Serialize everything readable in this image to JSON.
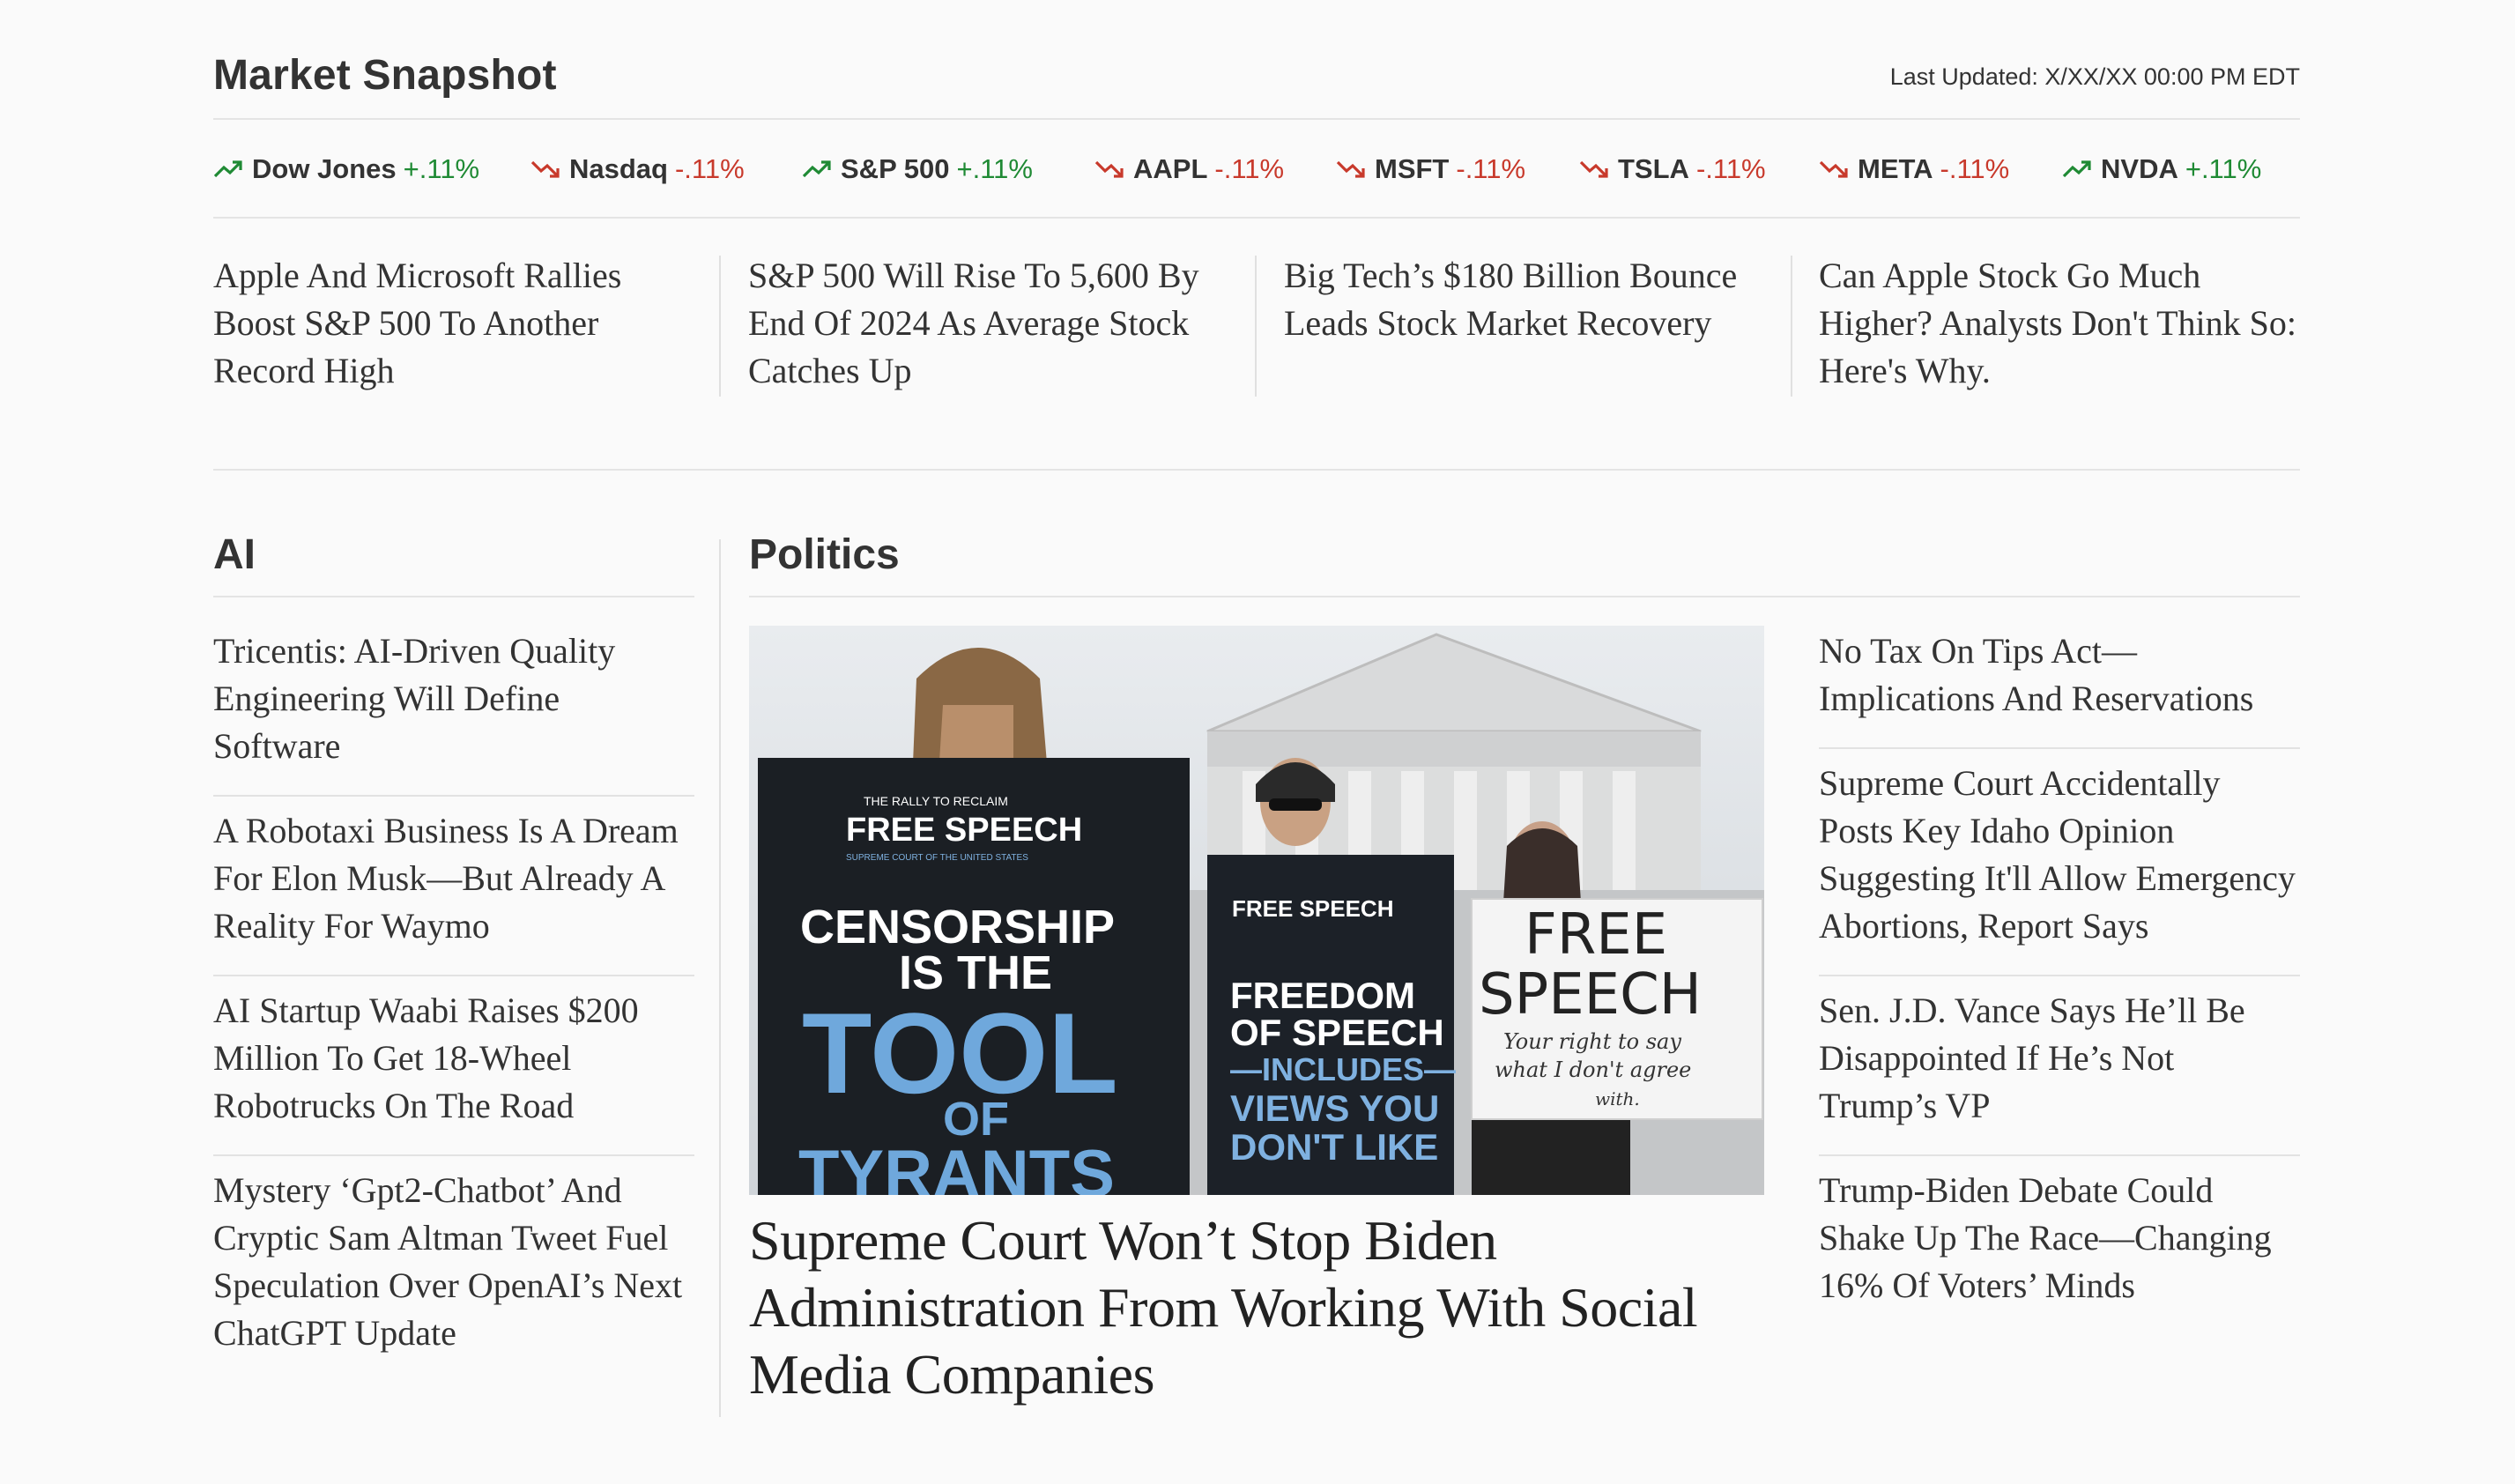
{
  "market": {
    "title": "Market Snapshot",
    "last_updated": "Last Updated: X/XX/XX 00:00 PM EDT",
    "tickers": [
      {
        "name": "Dow Jones",
        "change": "+.11%",
        "direction": "up"
      },
      {
        "name": "Nasdaq",
        "change": "-.11%",
        "direction": "down"
      },
      {
        "name": "S&P 500",
        "change": "+.11%",
        "direction": "up"
      },
      {
        "name": "AAPL",
        "change": "-.11%",
        "direction": "down"
      },
      {
        "name": "MSFT",
        "change": "-.11%",
        "direction": "down"
      },
      {
        "name": "TSLA",
        "change": "-.11%",
        "direction": "down"
      },
      {
        "name": "META",
        "change": "-.11%",
        "direction": "down"
      },
      {
        "name": "NVDA",
        "change": "+.11%",
        "direction": "up"
      }
    ],
    "headlines": [
      "Apple And Microsoft Rallies Boost S&P 500 To Another Record High",
      "S&P 500 Will Rise To 5,600 By End Of 2024 As Average Stock Catches Up",
      "Big Tech’s $180 Billion Bounce Leads Stock Market Recovery",
      "Can Apple Stock Go Much Higher? Analysts Don't Think So: Here's Why."
    ]
  },
  "ai": {
    "title": "AI",
    "items": [
      "Tricentis: AI-Driven Quality Engineering Will Define Software",
      "A Robotaxi Business Is A Dream For Elon Musk—But Already A Reality For Waymo",
      "AI Startup Waabi Raises $200 Million To Get 18-Wheel Robotrucks On The Road",
      "Mystery ‘Gpt2-Chatbot’ And Cryptic Sam Altman Tweet Fuel Speculation Over OpenAI’s Next ChatGPT Update"
    ]
  },
  "politics": {
    "title": "Politics",
    "lead_headline": "Supreme Court Won’t Stop Biden Administration From Working With Social Media Companies",
    "photo": {
      "sign1_top": "THE RALLY TO RECLAIM",
      "sign1_logo": "FREE SPEECH",
      "sign1_sub": "SUPREME COURT OF THE UNITED STATES",
      "sign1_line1": "CENSORSHIP",
      "sign1_line2": "IS THE",
      "sign1_line3": "TOOL",
      "sign1_line4": "OF",
      "sign1_line5": "TYRANTS",
      "sign2_logo": "FREE SPEECH",
      "sign2_line1": "FREEDOM",
      "sign2_line2": "OF SPEECH",
      "sign2_line3": "—INCLUDES—",
      "sign2_line4": "VIEWS YOU",
      "sign2_line5": "DON'T LIKE",
      "sign3_line1": "FREE",
      "sign3_line2": "SPEECH",
      "sign3_line3": "Your right to say",
      "sign3_line4": "what I don't agree",
      "sign3_line5": "with."
    },
    "items": [
      "No Tax On Tips Act—Implications And Reservations",
      "Supreme Court Accidentally Posts Key Idaho Opinion Suggesting It'll Allow Emergency Abortions, Report Says",
      "Sen. J.D. Vance Says He’ll Be Disappointed If He’s Not Trump’s VP",
      "Trump-Biden Debate Could Shake Up The Race—Changing 16% Of Voters’ Minds"
    ]
  },
  "colors": {
    "up": "#1f8a34",
    "down": "#c8392b",
    "text": "#333333",
    "rule": "#e4e4e4"
  },
  "icons": {
    "up": "trending-up-icon",
    "down": "trending-down-icon"
  }
}
